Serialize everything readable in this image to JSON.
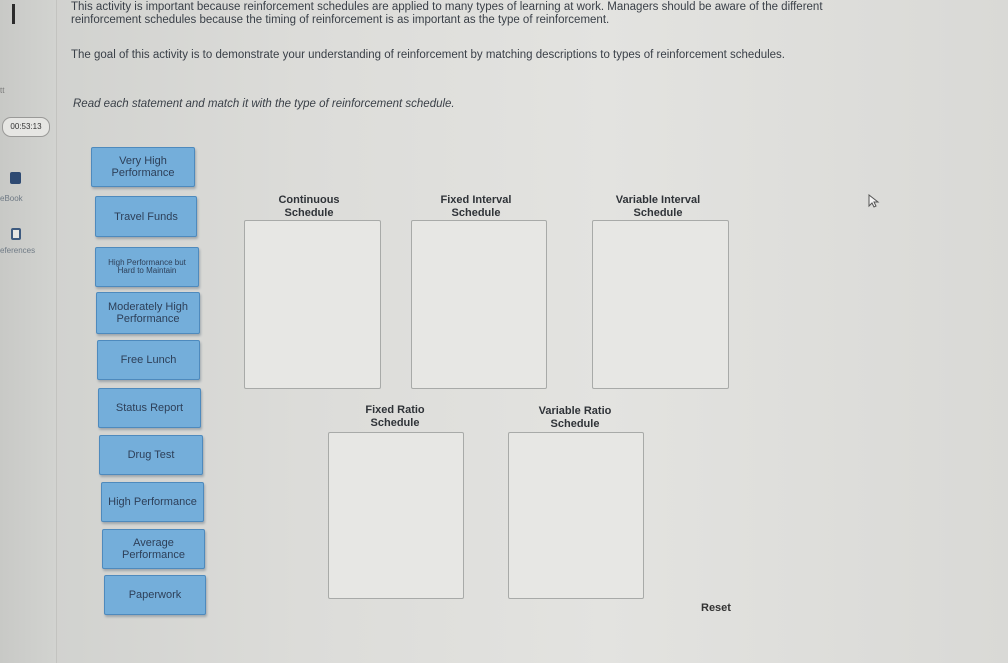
{
  "sidebar": {
    "small_text": "tt",
    "timer": "00:53:13",
    "ebook_label": "eBook",
    "references_label": "eferences"
  },
  "intro": {
    "paragraph1": "This activity is important because reinforcement schedules are applied to many types of learning at work. Managers should be aware of the different reinforcement schedules because the timing of reinforcement is as important as the type of reinforcement.",
    "paragraph2": "The goal of this activity is to demonstrate your understanding of reinforcement by matching descriptions to types of reinforcement schedules.",
    "instruction": "Read each statement and match it with the type of reinforcement schedule."
  },
  "cards": [
    "Very High Performance",
    "Travel Funds",
    "High Performance but Hard to Maintain",
    "Moderately High Performance",
    "Free Lunch",
    "Status Report",
    "Drug Test",
    "High Performance",
    "Average Performance",
    "Paperwork"
  ],
  "schedules": [
    "Continuous Schedule",
    "Fixed Interval Schedule",
    "Variable Interval Schedule",
    "Fixed Ratio Schedule",
    "Variable Ratio Schedule"
  ],
  "reset_label": "Reset",
  "colors": {
    "card": "#74aeda",
    "card_border": "#4e8abd",
    "background": "#dcdcd9"
  }
}
